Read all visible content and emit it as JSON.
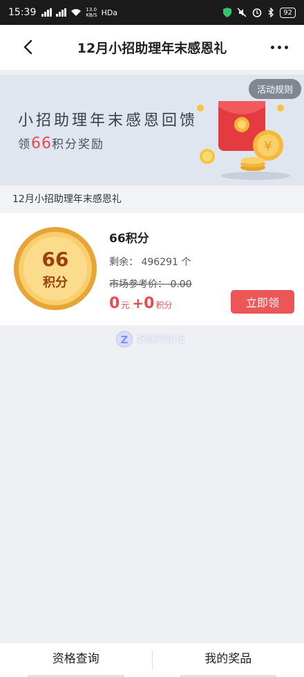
{
  "status_bar": {
    "time": "15:39",
    "net_speed_top": "13.0",
    "net_speed_bottom": "KB/S",
    "hd": "HDa",
    "battery": "92"
  },
  "header": {
    "title": "12月小招助理年末感恩礼"
  },
  "banner": {
    "rules_label": "活动规则",
    "title": "小招助理年末感恩回馈",
    "sub_prefix": "领",
    "sub_number": "66",
    "sub_suffix": "积分奖励"
  },
  "section": {
    "label": "12月小招助理年末感恩礼"
  },
  "product": {
    "coin_number": "66",
    "coin_unit": "积分",
    "name": "66积分",
    "remain_label": "剩余：",
    "remain_value": "496291",
    "remain_unit": "个",
    "market_label": "市场参考价：",
    "market_value": "0.00",
    "price_yuan": "0",
    "price_yuan_unit": "元",
    "price_plus": "+",
    "price_points": "0",
    "price_points_unit": "积分",
    "redeem_label": "立即领"
  },
  "watermark": {
    "text": "好赚网论坛"
  },
  "bottom_tabs": [
    {
      "label": "资格查询"
    },
    {
      "label": "我的奖品"
    }
  ],
  "colors": {
    "accent": "#ec5657",
    "banner_bg": "#dfe6ef",
    "page_bg": "#eef0f4"
  }
}
